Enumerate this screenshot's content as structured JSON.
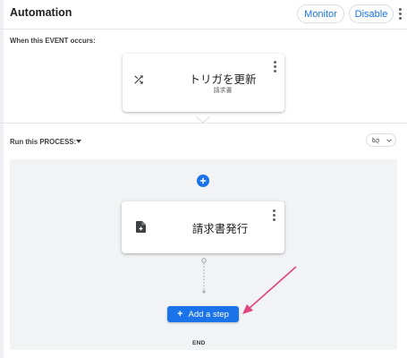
{
  "header": {
    "title": "Automation",
    "monitor_label": "Monitor",
    "disable_label": "Disable"
  },
  "event_section": {
    "label": "When this EVENT occurs:",
    "card": {
      "icon": "shuffle-icon",
      "title": "トリガを更新",
      "subtitle": "請求書"
    }
  },
  "process_section": {
    "label": "Run this PROCESS:",
    "step": {
      "icon": "document-add-icon",
      "title": "請求書発行"
    },
    "add_step_label": "Add a step",
    "end_label": "END"
  },
  "colors": {
    "accent": "#1a73e8",
    "process_background": "#f1f3f4",
    "annotation_arrow": "#e0457b"
  }
}
